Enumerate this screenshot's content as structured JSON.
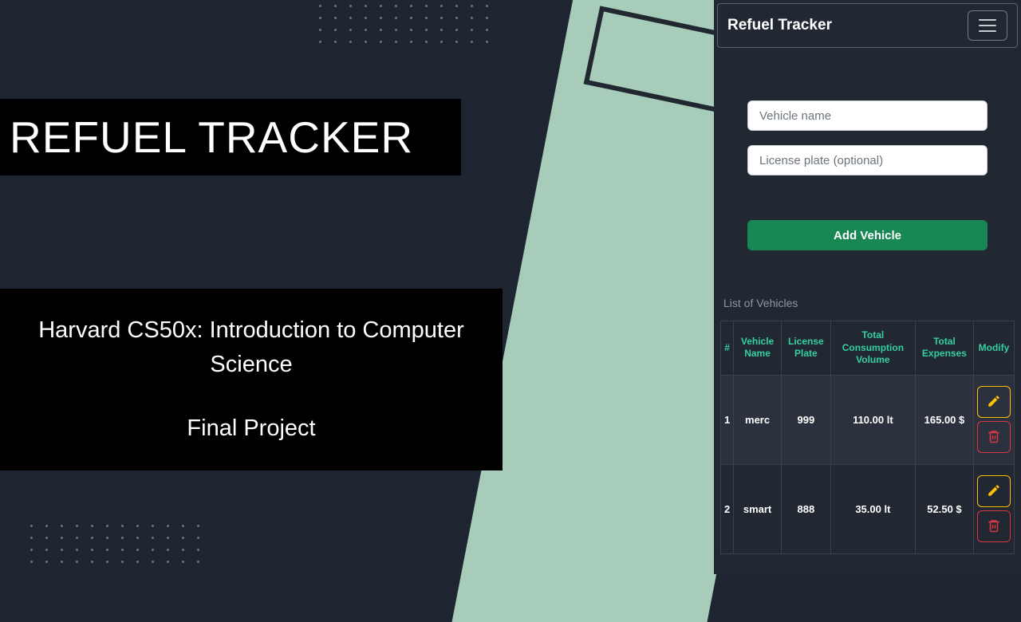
{
  "left": {
    "title": "REFUEL TRACKER",
    "subtitle1": "Harvard CS50x: Introduction to Computer Science",
    "subtitle2": "Final Project"
  },
  "nav": {
    "brand": "Refuel Tracker"
  },
  "form": {
    "vehicle_name_placeholder": "Vehicle name",
    "license_plate_placeholder": "License plate (optional)",
    "add_button": "Add Vehicle"
  },
  "list": {
    "label": "List of Vehicles",
    "headers": {
      "idx": "#",
      "name": "Vehicle Name",
      "plate": "License Plate",
      "volume": "Total Consumption Volume",
      "expenses": "Total Expenses",
      "modify": "Modify"
    },
    "rows": [
      {
        "idx": "1",
        "name": "merc",
        "plate": "999",
        "volume": "110.00 lt",
        "expenses": "165.00 $"
      },
      {
        "idx": "2",
        "name": "smart",
        "plate": "888",
        "volume": "35.00 lt",
        "expenses": "52.50 $"
      }
    ]
  },
  "colors": {
    "accent_green": "#198754",
    "header_teal": "#34cfa1",
    "warning": "#ffc107",
    "danger": "#dc3545",
    "mint": "#a8ccba",
    "bg": "#222831"
  }
}
